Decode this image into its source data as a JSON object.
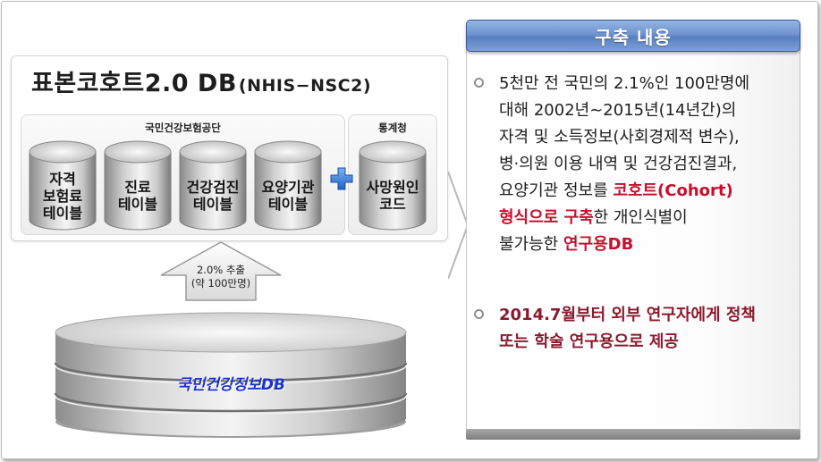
{
  "title": {
    "main": "표본코호트2.0 DB",
    "sub": "(NHIS−NSC2)"
  },
  "groups": {
    "nhis": {
      "label": "국민건강보험공단",
      "tables": [
        {
          "label": "자격\n보험료\n테이블"
        },
        {
          "label": "진료\n테이블"
        },
        {
          "label": "건강검진\n테이블"
        },
        {
          "label": "요양기관\n테이블"
        }
      ]
    },
    "stat": {
      "label": "통계청",
      "tables": [
        {
          "label": "사망원인\n코드"
        }
      ]
    }
  },
  "arrow": {
    "line1": "2.0% 추출",
    "line2": "(약 100만명)"
  },
  "source_db": {
    "label": "국민건강정보DB"
  },
  "content": {
    "header": "구축 내용",
    "bullet1": {
      "line1": "5천만 전 국민의 2.1%인 100만명에",
      "line2": "대해 2002년~2015년(14년간)의",
      "line3": "자격 및 소득정보(사회경제적 변수),",
      "line4": "병·의원 이용 내역 및 건강검진결과,",
      "line5_a": "요양기관 정보를 ",
      "line5_b": "코호트(Cohort)",
      "line6_a": "형식으로 구축",
      "line6_b": "한 개인식별이",
      "line7_a": "불가능한 ",
      "line7_b": "연구용DB"
    },
    "bullet2": {
      "line1": "2014.7월부터 외부 연구자에게 정책",
      "line2": "또는 학술 연구용으로 제공"
    }
  },
  "colors": {
    "header_blue": "#6f93d0",
    "highlight_red": "#c8102e",
    "highlight_maroon": "#8b1a2e",
    "db_label_blue": "#1d32c8"
  }
}
